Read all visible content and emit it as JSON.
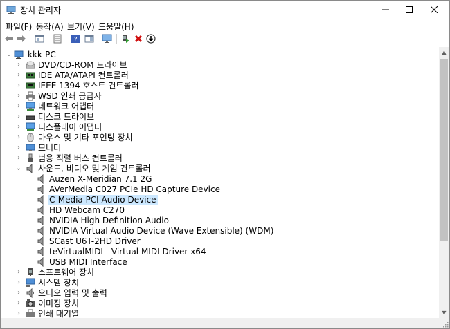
{
  "window": {
    "title": "장치 관리자",
    "minimize_glyph": "—",
    "maximize_glyph": "☐",
    "close_glyph": "✕"
  },
  "menu": {
    "items": [
      {
        "label": "파일(F)"
      },
      {
        "label": "동작(A)"
      },
      {
        "label": "보기(V)"
      },
      {
        "label": "도움말(H)"
      }
    ]
  },
  "toolbar": {
    "buttons": [
      {
        "icon": "back-arrow-icon"
      },
      {
        "icon": "forward-arrow-icon"
      },
      {
        "icon": "show-hide-console-tree-icon"
      },
      {
        "icon": "properties-icon"
      },
      {
        "icon": "help-icon"
      },
      {
        "icon": "action-pane-icon"
      },
      {
        "icon": "scan-hardware-icon"
      },
      {
        "icon": "update-driver-icon"
      },
      {
        "icon": "uninstall-device-icon"
      },
      {
        "icon": "disable-device-icon"
      }
    ]
  },
  "tree": {
    "root": {
      "label": "kkk-PC",
      "expanded": true
    },
    "categories": [
      {
        "label": "DVD/CD-ROM 드라이브",
        "icon": "dvd-drive-icon",
        "expanded": false
      },
      {
        "label": "IDE ATA/ATAPI 컨트롤러",
        "icon": "ide-controller-icon",
        "expanded": false
      },
      {
        "label": "IEEE 1394 호스트 컨트롤러",
        "icon": "ieee1394-controller-icon",
        "expanded": false
      },
      {
        "label": "WSD 인쇄 공급자",
        "icon": "printer-icon",
        "expanded": false
      },
      {
        "label": "네트워크 어댑터",
        "icon": "network-adapter-icon",
        "expanded": false
      },
      {
        "label": "디스크 드라이브",
        "icon": "disk-drive-icon",
        "expanded": false
      },
      {
        "label": "디스플레이 어댑터",
        "icon": "display-adapter-icon",
        "expanded": false
      },
      {
        "label": "마우스 및 기타 포인팅 장치",
        "icon": "mouse-icon",
        "expanded": false
      },
      {
        "label": "모니터",
        "icon": "monitor-icon",
        "expanded": false
      },
      {
        "label": "범용 직렬 버스 컨트롤러",
        "icon": "usb-controller-icon",
        "expanded": false
      },
      {
        "label": "사운드, 비디오 및 게임 컨트롤러",
        "icon": "speaker-icon",
        "expanded": true,
        "children": [
          {
            "label": "Auzen X-Meridian 7.1 2G",
            "selected": false
          },
          {
            "label": "AVerMedia C027 PCIe HD Capture Device",
            "selected": false
          },
          {
            "label": "C-Media PCI Audio Device",
            "selected": true
          },
          {
            "label": "HD Webcam C270",
            "selected": false
          },
          {
            "label": "NVIDIA High Definition Audio",
            "selected": false
          },
          {
            "label": "NVIDIA Virtual Audio Device (Wave Extensible) (WDM)",
            "selected": false
          },
          {
            "label": "SCast U6T-2HD Driver",
            "selected": false
          },
          {
            "label": "teVirtualMIDI - Virtual MIDI Driver x64",
            "selected": false
          },
          {
            "label": "USB MIDI Interface",
            "selected": false
          }
        ]
      },
      {
        "label": "소프트웨어 장치",
        "icon": "software-device-icon",
        "expanded": false
      },
      {
        "label": "시스템 장치",
        "icon": "system-device-icon",
        "expanded": false
      },
      {
        "label": "오디오 입력 및 출력",
        "icon": "audio-io-icon",
        "expanded": false
      },
      {
        "label": "이미징 장치",
        "icon": "imaging-device-icon",
        "expanded": false
      },
      {
        "label": "인쇄 대기열",
        "icon": "print-queue-icon",
        "expanded": false
      }
    ]
  },
  "colors": {
    "selection": "#cce8ff",
    "chevron": "#7a7a7a",
    "uninstall_red": "#d01010",
    "scan_green": "#2a9a2a"
  }
}
